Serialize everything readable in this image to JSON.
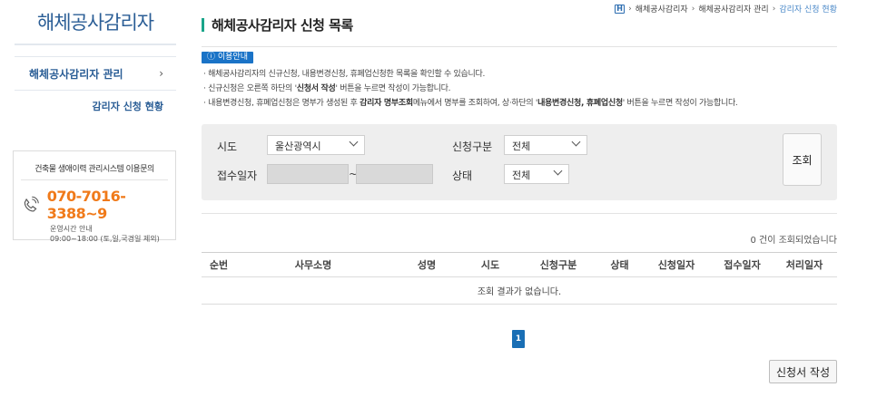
{
  "sidebar": {
    "title": "해체공사감리자",
    "nav_item_label": "해체공사감리자 관리",
    "nav_item_chevron": "›",
    "sub_item_label": "감리자 신청 현황",
    "contact": {
      "title": "건축물 생애이력 관리시스템 이용문의",
      "phone": "070-7016-3388~9",
      "hours_label": "운영시간 안내",
      "hours_value": "09:00~18:00 (토,일,국경일 제외)"
    }
  },
  "breadcrumb": {
    "home_icon": "home-icon",
    "home_glyph": "H",
    "items": [
      "해체공사감리자",
      "해체공사감리자 관리",
      "감리자 신청 현황"
    ]
  },
  "page": {
    "title": "해체공사감리자 신청 목록"
  },
  "guide": {
    "badge": "ⓘ 이용안내",
    "line1": "· 해체공사감리자의 신규신청, 내용변경신청, 휴폐업신청한 목록을 확인할 수 있습니다.",
    "line2_pre": "· 신규신청은 오른쪽 하단의 '",
    "line2_bold": "신청서 작성",
    "line2_post": "' 버튼을 누르면 작성이 가능합니다.",
    "line3_pre": "· 내용변경신청, 휴폐업신청은 명부가 생성된 후 ",
    "line3_bold1": "감리자 명부조회",
    "line3_mid": "메뉴에서 명부를 조회하여, 상·하단의 '",
    "line3_bold2": "내용변경신청, 휴폐업신청",
    "line3_post": "' 버튼을 누르면 작성이 가능합니다."
  },
  "search": {
    "region_label": "시도",
    "region_value": "울산광역시",
    "type_label": "신청구분",
    "type_value": "전체",
    "date_label": "접수일자",
    "date_sep": "~",
    "status_label": "상태",
    "status_value": "전체",
    "search_button": "조회"
  },
  "results": {
    "count_text": "0 건이 조회되었습니다",
    "columns": [
      "순번",
      "사무소명",
      "성명",
      "시도",
      "신청구분",
      "상태",
      "신청일자",
      "접수일자",
      "처리일자"
    ],
    "empty_text": "조회 결과가 없습니다."
  },
  "pagination": {
    "current_page": "1"
  },
  "actions": {
    "write_button": "신청서 작성"
  },
  "colors": {
    "brand_blue": "#2b5e96",
    "accent_orange": "#f07a1a",
    "title_bar_green": "#1aa58a",
    "badge_blue": "#1a73c7"
  }
}
